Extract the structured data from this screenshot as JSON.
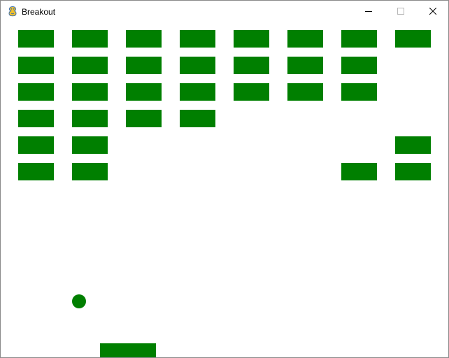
{
  "window": {
    "title": "Breakout",
    "icon": "pygame-snake-icon",
    "controls": [
      "minimize-icon",
      "maximize-icon",
      "close-icon"
    ]
  },
  "game": {
    "colors": {
      "brick": "#007f00",
      "ball": "#007f00",
      "paddle": "#007f00",
      "background": "#ffffff"
    },
    "brick_grid": {
      "rows": 6,
      "columns": 8,
      "bricks_present": [
        [
          1,
          1,
          1,
          1,
          1,
          1,
          1,
          1
        ],
        [
          1,
          1,
          1,
          1,
          1,
          1,
          1,
          0
        ],
        [
          1,
          1,
          1,
          1,
          1,
          1,
          1,
          0
        ],
        [
          1,
          1,
          1,
          1,
          0,
          0,
          0,
          0
        ],
        [
          1,
          1,
          0,
          0,
          0,
          0,
          0,
          1
        ],
        [
          1,
          1,
          0,
          0,
          0,
          0,
          1,
          1
        ]
      ]
    }
  }
}
